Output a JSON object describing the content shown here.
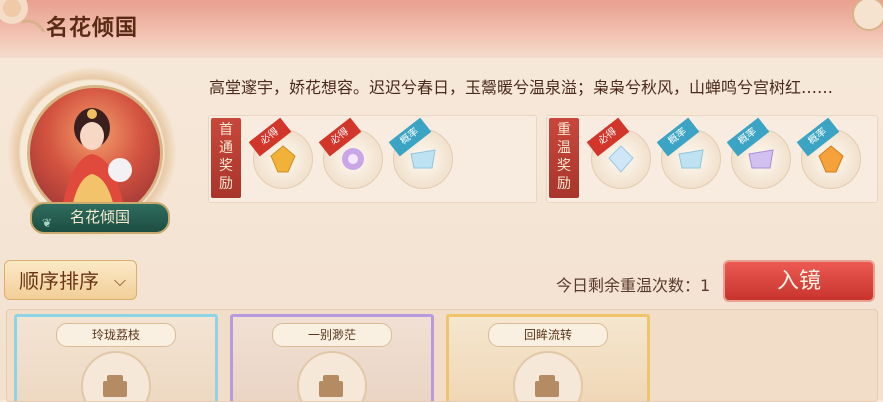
{
  "header": {
    "title": "名花倾国"
  },
  "portrait": {
    "name": "名花倾国"
  },
  "poem": "高堂邃宇，娇花想容。迟迟兮春日，玉鬶暖兮温泉溢；枭枭兮秋风，山蝉鸣兮宫树红……",
  "first_reward": {
    "label_chars": [
      "首",
      "通",
      "奖",
      "励"
    ],
    "items": [
      {
        "tag": "必得",
        "icon": "gold-gem-icon"
      },
      {
        "tag": "必得",
        "icon": "purple-flower-gem-icon"
      },
      {
        "tag": "概率",
        "icon": "ice-crystal-icon"
      }
    ]
  },
  "repeat_reward": {
    "label_chars": [
      "重",
      "温",
      "奖",
      "励"
    ],
    "items": [
      {
        "tag": "必得",
        "icon": "blue-crystal-icon"
      },
      {
        "tag": "概率",
        "icon": "ice-crystal-icon"
      },
      {
        "tag": "概率",
        "icon": "purple-crystal-icon"
      },
      {
        "tag": "概率",
        "icon": "orange-gem-icon"
      }
    ]
  },
  "sort": {
    "label": "顺序排序"
  },
  "remain": {
    "text": "今日剩余重温次数：1"
  },
  "enter": {
    "label": "入镜"
  },
  "cards": [
    {
      "title": "玲珑荔枝"
    },
    {
      "title": "一别渺茫"
    },
    {
      "title": "回眸流转"
    }
  ],
  "colors": {
    "accent_red": "#c8332e",
    "card_blue": "#8fd4e6",
    "card_purple": "#b79ae0",
    "card_gold": "#f0c56a"
  }
}
